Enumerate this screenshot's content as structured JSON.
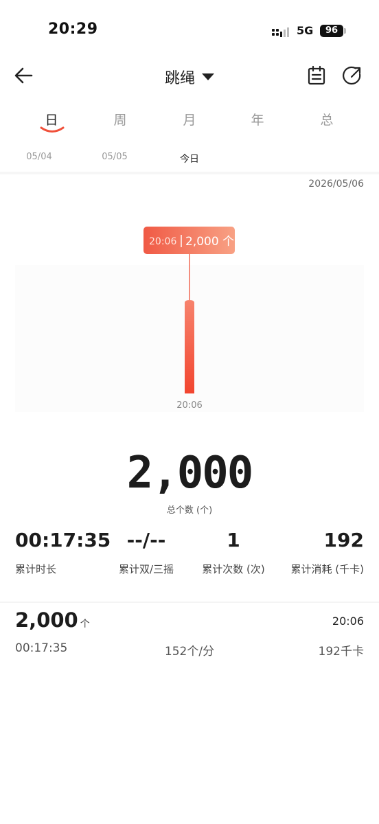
{
  "status": {
    "time": "20:29",
    "network": "5G",
    "battery": "96"
  },
  "header": {
    "title": "跳绳"
  },
  "period_tabs": [
    "日",
    "周",
    "月",
    "年",
    "总"
  ],
  "date_tabs": [
    "05/04",
    "05/05",
    "今日"
  ],
  "selected_date": "2026/05/06",
  "chart_data": {
    "type": "bar",
    "categories": [
      "20:06"
    ],
    "values": [
      2000
    ],
    "tooltip": {
      "time": "20:06",
      "value": "2,000 个"
    },
    "colors": {
      "bar_top": "#f7836d",
      "bar_bottom": "#f2452f"
    }
  },
  "summary": {
    "total": "2,000",
    "total_label": "总个数 (个)"
  },
  "stats": [
    {
      "value": "00:17:35",
      "label": "累计时长"
    },
    {
      "value": "--/--",
      "label": "累计双/三摇"
    },
    {
      "value": "1",
      "label": "累计次数 (次)"
    },
    {
      "value": "192",
      "label": "累计消耗 (千卡)"
    }
  ],
  "record": {
    "count": "2,000",
    "unit": "个",
    "time": "20:06",
    "duration": "00:17:35",
    "pace": "152个/分",
    "calories": "192千卡"
  },
  "accent_color": "#f0503a"
}
